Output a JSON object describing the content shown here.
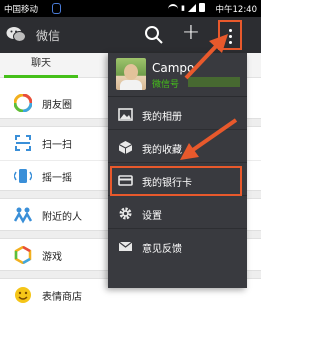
{
  "status_bar": {
    "carrier": "中国移动",
    "time": "中午12:40"
  },
  "header": {
    "title": "微信",
    "search_icon": "search-icon",
    "add_icon": "plus-icon",
    "more_icon": "more-vertical-icon",
    "plus_glyph": "+"
  },
  "tabs": {
    "chat_label": "聊天"
  },
  "discover": {
    "items": [
      {
        "label": "朋友圈",
        "icon": "moments-icon"
      },
      {
        "label": "扫一扫",
        "icon": "scan-icon"
      },
      {
        "label": "摇一摇",
        "icon": "shake-icon"
      },
      {
        "label": "附近的人",
        "icon": "people-nearby-icon"
      },
      {
        "label": "游戏",
        "icon": "games-icon"
      },
      {
        "label": "表情商店",
        "icon": "sticker-store-icon"
      }
    ]
  },
  "menu": {
    "profile": {
      "name": "Campo",
      "wechat_id_label": "微信号"
    },
    "items": [
      {
        "label": "我的相册",
        "icon": "photo-album-icon"
      },
      {
        "label": "我的收藏",
        "icon": "favorites-icon"
      },
      {
        "label": "我的银行卡",
        "icon": "bank-card-icon"
      },
      {
        "label": "设置",
        "icon": "gear-icon"
      },
      {
        "label": "意见反馈",
        "icon": "feedback-icon"
      }
    ]
  },
  "colors": {
    "accent_green": "#45c01a",
    "annotation_orange": "#e8592c",
    "header_bg": "#2c2d31",
    "menu_bg": "#393a3f"
  }
}
